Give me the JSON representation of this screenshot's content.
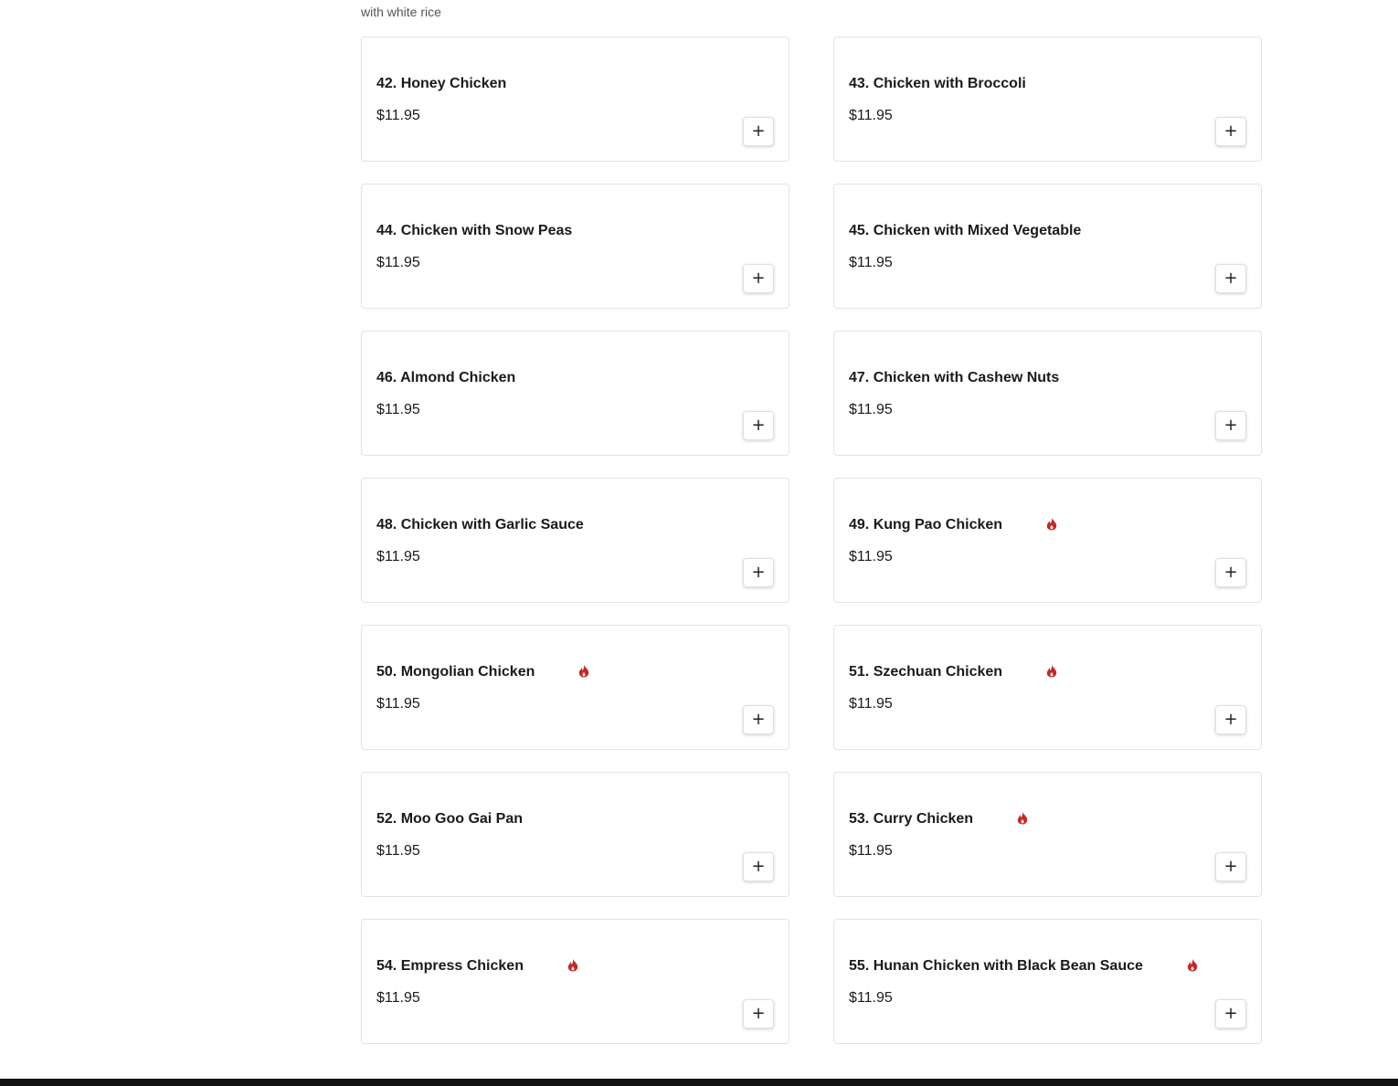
{
  "section": {
    "note": "with white rice"
  },
  "items": [
    {
      "name": "42. Honey Chicken",
      "price": "$11.95",
      "spicy": false,
      "add_label": "+"
    },
    {
      "name": "43. Chicken with Broccoli",
      "price": "$11.95",
      "spicy": false,
      "add_label": "+"
    },
    {
      "name": "44. Chicken with Snow Peas",
      "price": "$11.95",
      "spicy": false,
      "add_label": "+"
    },
    {
      "name": "45. Chicken with Mixed Vegetable",
      "price": "$11.95",
      "spicy": false,
      "add_label": "+"
    },
    {
      "name": "46. Almond Chicken",
      "price": "$11.95",
      "spicy": false,
      "add_label": "+"
    },
    {
      "name": "47. Chicken with Cashew Nuts",
      "price": "$11.95",
      "spicy": false,
      "add_label": "+"
    },
    {
      "name": "48. Chicken with Garlic Sauce",
      "price": "$11.95",
      "spicy": false,
      "add_label": "+"
    },
    {
      "name": "49. Kung Pao Chicken",
      "price": "$11.95",
      "spicy": true,
      "add_label": "+"
    },
    {
      "name": "50. Mongolian Chicken",
      "price": "$11.95",
      "spicy": true,
      "add_label": "+"
    },
    {
      "name": "51. Szechuan Chicken",
      "price": "$11.95",
      "spicy": true,
      "add_label": "+"
    },
    {
      "name": "52. Moo Goo Gai Pan",
      "price": "$11.95",
      "spicy": false,
      "add_label": "+"
    },
    {
      "name": "53. Curry Chicken",
      "price": "$11.95",
      "spicy": true,
      "add_label": "+"
    },
    {
      "name": "54. Empress Chicken",
      "price": "$11.95",
      "spicy": true,
      "add_label": "+"
    },
    {
      "name": "55. Hunan Chicken with Black Bean Sauce",
      "price": "$11.95",
      "spicy": true,
      "add_label": "+"
    }
  ],
  "colors": {
    "spicy_icon": "#c62828",
    "footer": "#111111"
  },
  "icons": {
    "spicy": "flame-icon",
    "add": "plus-icon"
  }
}
